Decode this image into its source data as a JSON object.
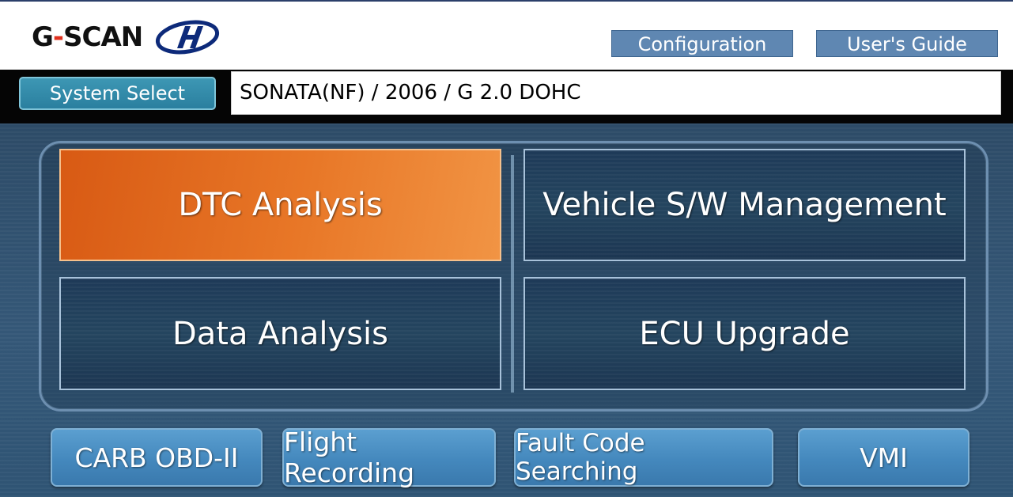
{
  "header": {
    "logo_text_prefix": "G",
    "logo_text_dash": "-",
    "logo_text_suffix": "SCAN",
    "brand_icon": "hyundai-logo-icon",
    "configuration_label": "Configuration",
    "users_guide_label": "User's Guide"
  },
  "system_bar": {
    "system_select_label": "System Select",
    "vehicle_value": "SONATA(NF) / 2006 / G 2.0 DOHC"
  },
  "main_menu": {
    "items": [
      {
        "label": "DTC Analysis",
        "state": "selected"
      },
      {
        "label": "Vehicle S/W Management",
        "state": "normal"
      },
      {
        "label": "Data Analysis",
        "state": "normal"
      },
      {
        "label": "ECU Upgrade",
        "state": "normal"
      }
    ]
  },
  "bottom_menu": {
    "items": [
      {
        "label": "CARB OBD-II"
      },
      {
        "label": "Flight Recording"
      },
      {
        "label": "Fault Code Searching"
      },
      {
        "label": "VMI"
      }
    ]
  },
  "colors": {
    "accent_orange": "#e87727",
    "header_button": "#5f87b2",
    "panel_background": "#2d4b67",
    "bottom_button": "#4488bd",
    "logo_dash_red": "#e0301e"
  }
}
